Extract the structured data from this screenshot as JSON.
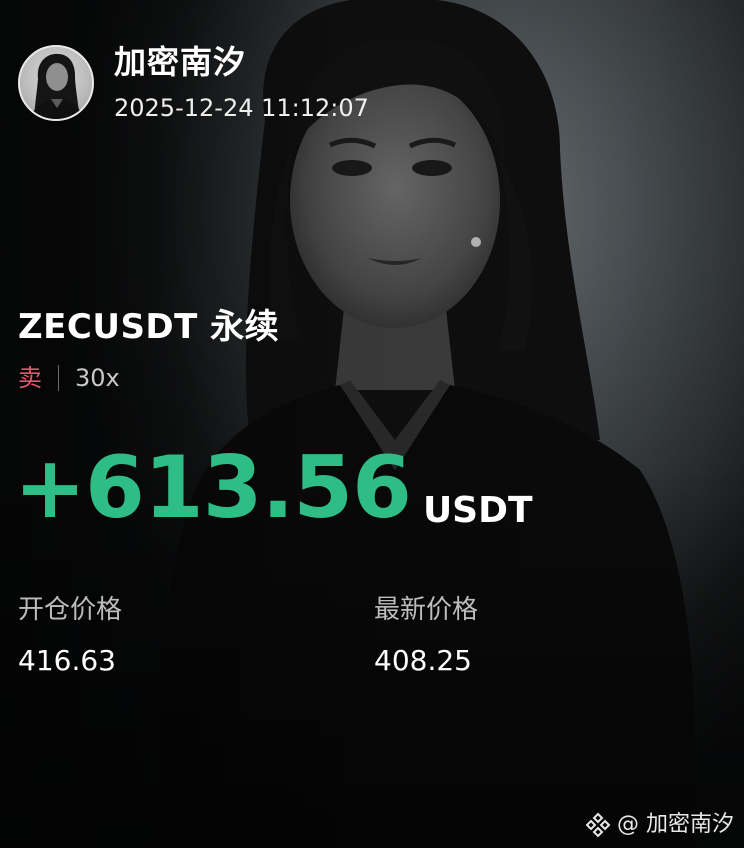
{
  "user": {
    "name": "加密南汐",
    "timestamp": "2025-12-24 11:12:07"
  },
  "position": {
    "pair": "ZECUSDT 永续",
    "side": "卖",
    "leverage": "30x",
    "pnl": "+613.56",
    "pnl_unit": "USDT",
    "entry_price_label": "开仓价格",
    "entry_price": "416.63",
    "last_price_label": "最新价格",
    "last_price": "408.25"
  },
  "watermark": {
    "text": "@ 加密南汐",
    "icon": "binance-square-icon"
  },
  "colors": {
    "profit": "#2ebd85",
    "sell": "#e5566d",
    "background": "#0b0c0d"
  }
}
